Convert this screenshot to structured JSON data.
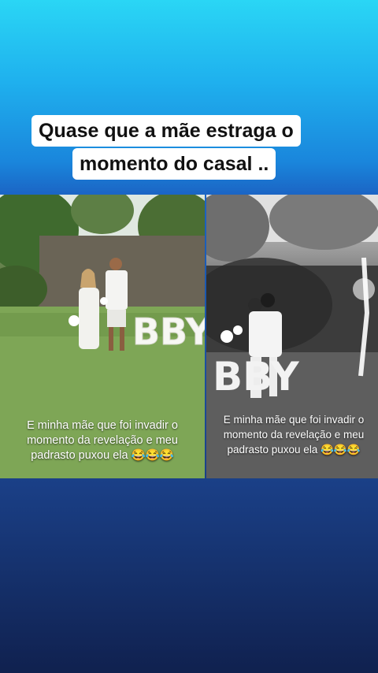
{
  "title": {
    "line1": "Quase que a mãe estraga o",
    "line2": "momento do casal .."
  },
  "left_panel": {
    "caption": "E minha mãe que foi invadir o momento da revelação e meu padrasto puxou ela 😂😂😂",
    "sign": "BBY"
  },
  "right_panel": {
    "caption": "E minha mãe que foi invadir o momento da revelação e meu padrasto puxou ela 😂😂😂",
    "sign": "BBY"
  },
  "colors": {
    "bg_top": "#2ad6f5",
    "bg_bottom": "#10214f",
    "title_bg": "#ffffff"
  }
}
